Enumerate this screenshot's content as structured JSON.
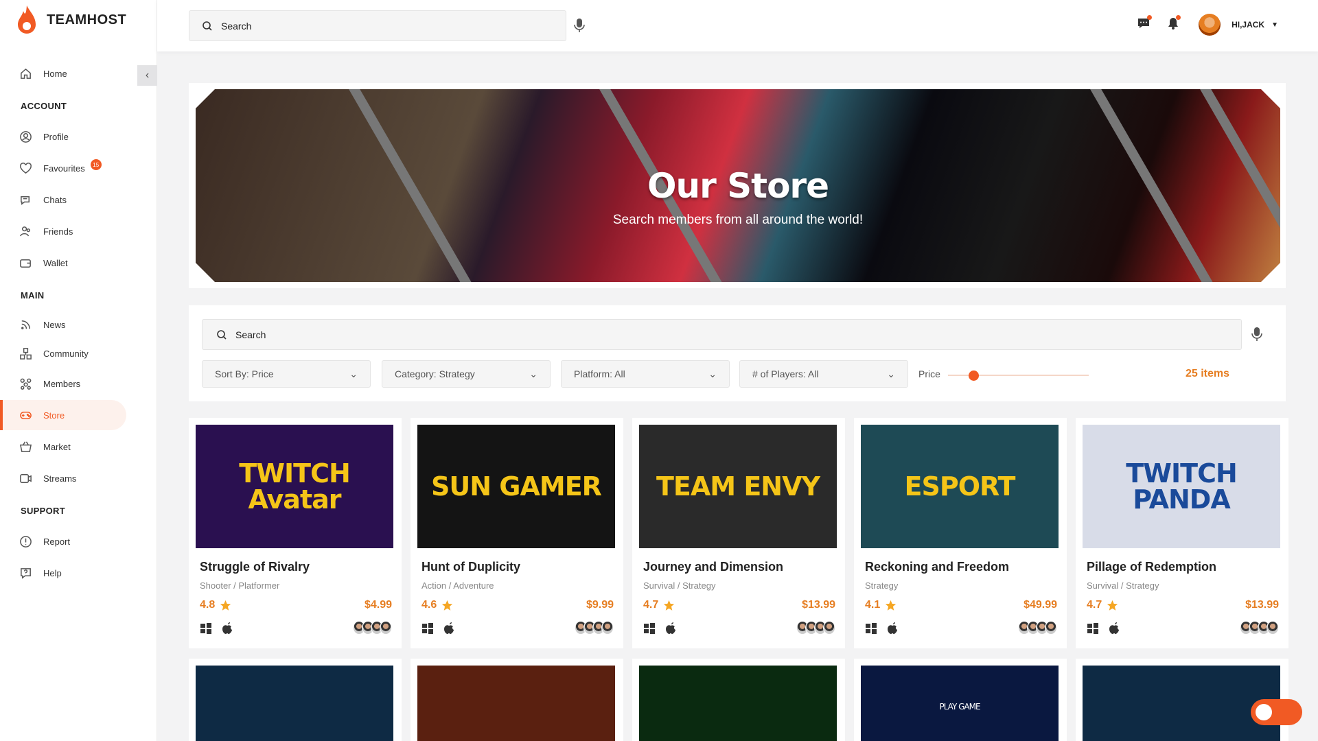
{
  "app": {
    "name": "TEAMHOST"
  },
  "sidebar": {
    "home": "Home",
    "sections": {
      "account": "ACCOUNT",
      "main": "MAIN",
      "support": "SUPPORT"
    },
    "account_items": [
      {
        "label": "Profile",
        "icon": "user-circle-icon"
      },
      {
        "label": "Favourites",
        "icon": "heart-icon",
        "badge": "15"
      },
      {
        "label": "Chats",
        "icon": "chat-icon"
      },
      {
        "label": "Friends",
        "icon": "friends-icon"
      },
      {
        "label": "Wallet",
        "icon": "wallet-icon"
      }
    ],
    "main_items": [
      {
        "label": "News",
        "icon": "rss-icon"
      },
      {
        "label": "Community",
        "icon": "community-icon"
      },
      {
        "label": "Members",
        "icon": "members-icon"
      },
      {
        "label": "Store",
        "icon": "gamepad-icon",
        "active": true
      },
      {
        "label": "Market",
        "icon": "basket-icon"
      },
      {
        "label": "Streams",
        "icon": "streams-icon"
      }
    ],
    "support_items": [
      {
        "label": "Report",
        "icon": "alert-icon"
      },
      {
        "label": "Help",
        "icon": "help-icon"
      }
    ]
  },
  "topbar": {
    "search_placeholder": "Search",
    "user_greeting": "HI,JACK"
  },
  "banner": {
    "title": "Our Store",
    "subtitle": "Search members from all around the world!"
  },
  "filters": {
    "search_placeholder": "Search",
    "sort": "Sort By: Price",
    "category": "Category: Strategy",
    "platform": "Platform: All",
    "players": "# of Players: All",
    "price_label": "Price",
    "price_level": 0.18,
    "items_count": "25 items"
  },
  "games": [
    {
      "title": "Struggle of Rivalry",
      "genre": "Shooter / Platformer",
      "rating": "4.8",
      "price": "$4.99",
      "art": "TWITCH Avatar",
      "bg": "#2a1050"
    },
    {
      "title": "Hunt of Duplicity",
      "genre": "Action / Adventure",
      "rating": "4.6",
      "price": "$9.99",
      "art": "SUN GAMER",
      "bg": "#141414"
    },
    {
      "title": "Journey and Dimension",
      "genre": "Survival / Strategy",
      "rating": "4.7",
      "price": "$13.99",
      "art": "TEAM ENVY",
      "bg": "#2a2a2a"
    },
    {
      "title": "Reckoning and Freedom",
      "genre": "Strategy",
      "rating": "4.1",
      "price": "$49.99",
      "art": "ESPORT",
      "bg": "#1e4a55"
    },
    {
      "title": "Pillage of Redemption",
      "genre": "Survival / Strategy",
      "rating": "4.7",
      "price": "$13.99",
      "art": "TWITCH PANDA",
      "bg": "#d8dce8"
    }
  ],
  "second_row": [
    {
      "bg": "#0e2a44",
      "art": ""
    },
    {
      "bg": "#5a2010",
      "art": ""
    },
    {
      "bg": "#0a2a10",
      "art": ""
    },
    {
      "bg": "#0a1840",
      "art": "PLAY GAME"
    },
    {
      "bg": "#0e2a44",
      "art": ""
    }
  ],
  "colors": {
    "accent": "#f15a24",
    "price": "#e67e22"
  }
}
